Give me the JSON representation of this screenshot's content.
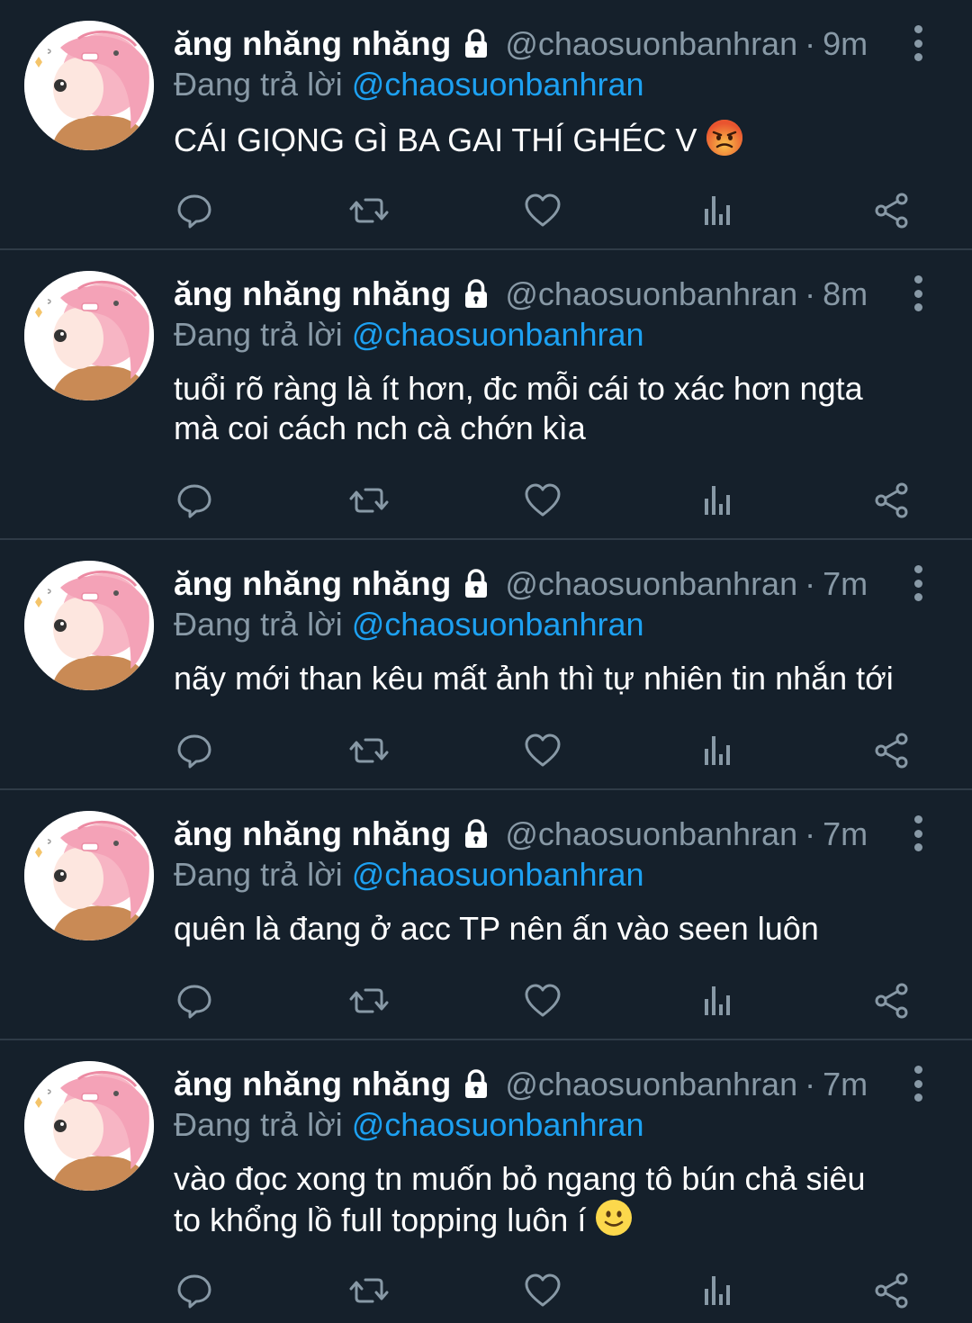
{
  "tweets": [
    {
      "display_name": "ăng nhăng nhăng",
      "handle": "@chaosuonbanhran",
      "separator": "·",
      "time": "9m",
      "reply_prefix": "Đang trả lời",
      "reply_to": "@chaosuonbanhran",
      "text": "CÁI GIỌNG GÌ BA GAI THÍ GHÉC V",
      "emoji": "angry-face"
    },
    {
      "display_name": "ăng nhăng nhăng",
      "handle": "@chaosuonbanhran",
      "separator": "·",
      "time": "8m",
      "reply_prefix": "Đang trả lời",
      "reply_to": "@chaosuonbanhran",
      "text": "tuổi rõ ràng là ít hơn, đc mỗi cái to xác hơn ngta\nmà coi cách nch cà chớn kìa"
    },
    {
      "display_name": "ăng nhăng nhăng",
      "handle": "@chaosuonbanhran",
      "separator": "·",
      "time": "7m",
      "reply_prefix": "Đang trả lời",
      "reply_to": "@chaosuonbanhran",
      "text": "nãy mới than kêu mất ảnh thì tự nhiên tin nhắn tới"
    },
    {
      "display_name": "ăng nhăng nhăng",
      "handle": "@chaosuonbanhran",
      "separator": "·",
      "time": "7m",
      "reply_prefix": "Đang trả lời",
      "reply_to": "@chaosuonbanhran",
      "text": "quên là đang ở acc TP nên ấn vào seen luôn"
    },
    {
      "display_name": "ăng nhăng nhăng",
      "handle": "@chaosuonbanhran",
      "separator": "·",
      "time": "7m",
      "reply_prefix": "Đang trả lời",
      "reply_to": "@chaosuonbanhran",
      "text": "vào đọc xong tn muốn bỏ ngang tô bún chả siêu\nto khổng lồ full topping luôn í",
      "emoji": "slightly-smiling-face"
    }
  ],
  "icons": {
    "reply": "reply-icon",
    "retweet": "retweet-icon",
    "like": "heart-icon",
    "analytics": "analytics-icon",
    "share": "share-icon",
    "more": "more-vertical-icon",
    "protected": "lock-icon"
  },
  "colors": {
    "background": "#15202b",
    "divider": "#2f3b47",
    "secondary_text": "#8899a6",
    "mention": "#1da1f2",
    "primary_text": "#ffffff"
  }
}
